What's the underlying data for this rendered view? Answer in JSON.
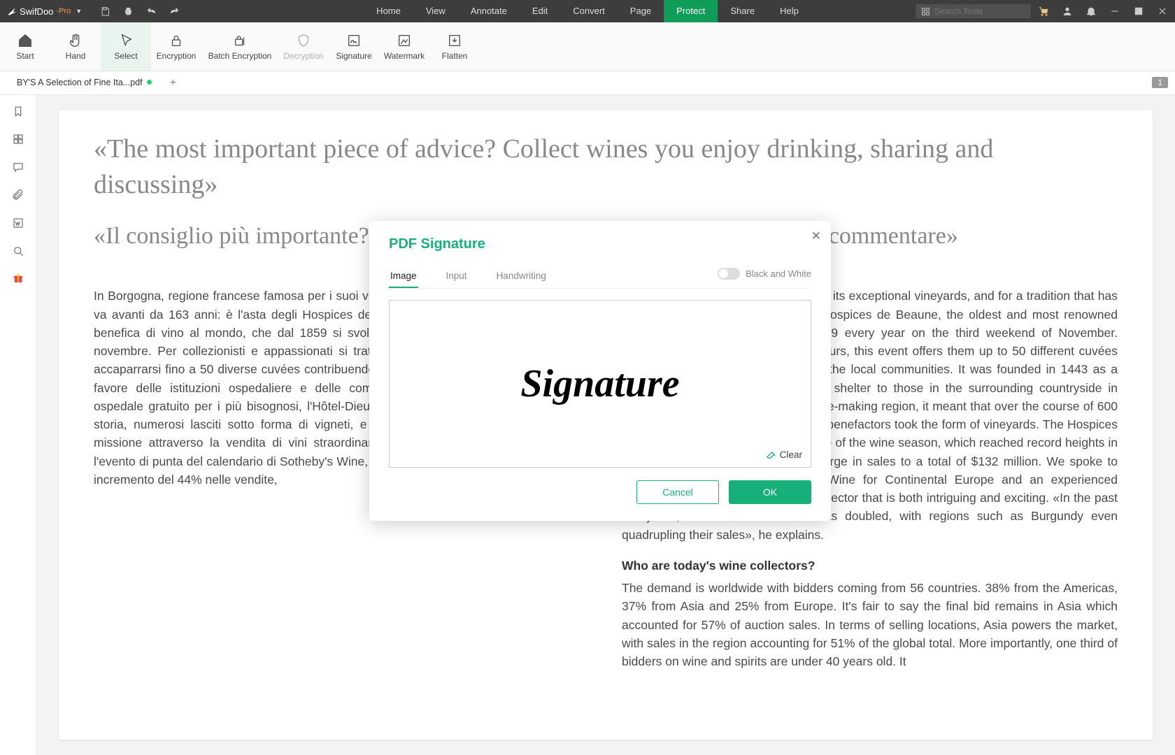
{
  "app": {
    "name": "SwifDoo",
    "suffix": "-Pro"
  },
  "menus": [
    "Home",
    "View",
    "Annotate",
    "Edit",
    "Convert",
    "Page",
    "Protect",
    "Share",
    "Help"
  ],
  "menu_active_index": 6,
  "search_placeholder": "Search Tools",
  "ribbon": {
    "start": "Start",
    "hand": "Hand",
    "select": "Select",
    "encryption": "Encryption",
    "batch": "Batch Encryption",
    "decryption": "Decryption",
    "signature": "Signature",
    "watermark": "Watermark",
    "flatten": "Flatten"
  },
  "tab_label": "BY'S A Selection of Fine Ita...pdf",
  "page_indicator": "1",
  "doc": {
    "quote_en": "«The most important piece of advice? Collect wines you enjoy drinking, sharing and discussing»",
    "quote_it": "«Il consiglio più importante? Colleziona vini che ti piace bere, condividere e commentare»",
    "col_left": "In Borgogna, regione francese famosa per i suoi vigneti eccezionali, c'è una tradizione che va avanti da 163 anni: è l'asta degli Hospices de Beaune, la più antica e rinomata asta benefica di vino al mondo, che dal 1859 si svolge ogni anno il terzo fine settimana di novembre. Per collezionisti e appassionati si tratta di un appuntamento imperdibile per accaparrarsi fino a 50 diverse cuvées contribuendo, al tempo stesso, a raccogliere fondi a favore delle istituzioni ospedaliere e delle comunità locali. Fondato nel 1443 come ospedale gratuito per i più bisognosi, l'Hôtel-Dieu de Beaune ha raccolto, in 600 anni di storia, numerosi lasciti sotto forma di vigneti, e oggi continua a portare avanti la sua missione attraverso la vendita di vini straordinari. L'asta degli Hospices de Beaune è l'evento di punta del calendario di Sotheby's Wine, che nel 2021 ha totalizzato 53 aste e un incremento del 44% nelle vendite,",
    "col_right_p1": "Burgundy, France, is world famous for its exceptional vineyards, and for a tradition that has been carried on for 163 years: the Hospices de Beaune, the oldest and most renowned charity wine auction, held since 1859 every year on the third weekend of November. Attended by collectors and connoisseurs, this event offers them up to 50 different cuvées while raising funds for hospitals and the local communities. It was founded in 1443 as a hospital offering free healthcare and shelter to those in the surrounding countryside in need. As Burgundy's most lauded wine-making region, it meant that over the course of 600 years, much of the donations from its benefactors took the form of vineyards. The Hospices de Beaune auction is now the pinnacle of the wine season, which reached record heights in 2021 with 53 auctions and a 44% surge in sales to a total of $132 million. We spoke to Rémi Barroux, Head of Sotheby's Wine for Continental Europe and an experienced collector, to give us an overview of a sector that is both intriguing and exciting. «In the past ten years, the fine wine market has doubled, with regions such as Burgundy even quadrupling their sales», he explains.",
    "col_right_h": "Who are today's wine collectors?",
    "col_right_p2": "The demand is worldwide with bidders coming from 56 countries. 38% from the Americas, 37% from Asia and 25% from Europe. It's fair to say the final bid remains in Asia which accounted for 57% of auction sales. In terms of selling locations, Asia powers the market, with sales in the region accounting for 51% of the global total. More importantly, one third of bidders on wine and spirits are under 40 years old. It"
  },
  "modal": {
    "title": "PDF Signature",
    "tabs": {
      "image": "Image",
      "input": "Input",
      "handwriting": "Handwriting"
    },
    "bw": "Black and White",
    "sig_text": "Signature",
    "clear": "Clear",
    "cancel": "Cancel",
    "ok": "OK"
  }
}
